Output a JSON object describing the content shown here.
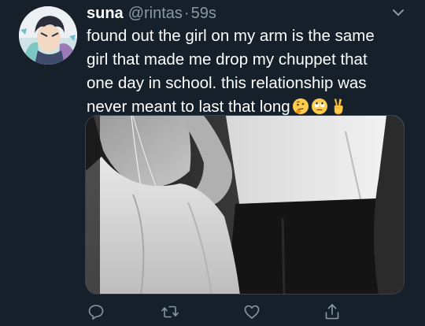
{
  "tweet": {
    "display_name": "suna",
    "handle": "@rintas",
    "separator": "·",
    "timestamp": "59s",
    "text_lines": [
      "found out the girl on my arm is the same",
      "girl that made me drop my chuppet that",
      "one day in school. this relationship was",
      "never meant to last that long"
    ],
    "emojis": [
      "thinking-face-emoji",
      "rolling-eyes-emoji",
      "victory-hand-emoji"
    ]
  },
  "media": {
    "description_icon": "photo"
  },
  "actions": {
    "reply": "reply-icon",
    "retweet": "retweet-icon",
    "like": "like-icon",
    "share": "share-icon"
  },
  "colors": {
    "background": "#15202b",
    "text": "#ffffff",
    "secondary": "#8899a6",
    "border": "#38444d"
  }
}
